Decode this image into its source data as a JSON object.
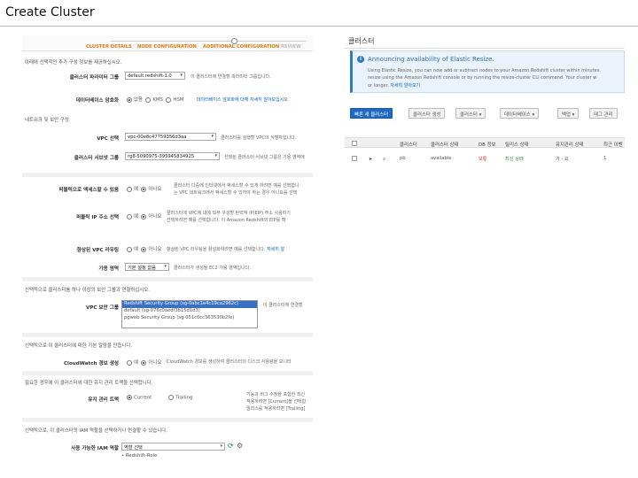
{
  "slide_title": "Create Cluster",
  "wizard": {
    "steps": [
      "CLUSTER DETAILS",
      "NODE CONFIGURATION",
      "ADDITIONAL CONFIGURATION",
      "REVIEW"
    ],
    "intro": "아래에 선택적인 추가 구성 정보를 제공하십시오.",
    "param_group": {
      "label": "클러스터 파라미터 그룹",
      "value": "default.redshift-1.0",
      "help": "이 클러스터에 연결할 파라미터 그룹입니다."
    },
    "encryption": {
      "label": "데이터베이스 암호화",
      "options": [
        "없음",
        "KMS",
        "HSM"
      ],
      "help": "데이터베이스 암호화에 대해 자세히 알아보십시오"
    },
    "network_heading": "네트워크 및 보안 구성",
    "vpc": {
      "label": "VPC 선택",
      "value": "vpc-00e8c47759356d3aa",
      "help": "클러스터를 실행할 VPC의 식별자입니다."
    },
    "subnet_group": {
      "label": "클러스터 서브넷 그룹",
      "value": "rg8-5090975-395945834925",
      "help": "선택된 클러스터 서브넷 그룹은 가용 영역에"
    },
    "publicly_accessible": {
      "label": "퍼블릭으로 액세스할 수 있음",
      "options": [
        "예",
        "아니요"
      ],
      "help": [
        "클러스터 다중에 인터넷에서 액세스할 수 있게 하려면 예를 선택합니",
        "는 VPC 네트워크에서 액세스할 수 있어야 하는 경우 아니요를 선택"
      ]
    },
    "public_ip": {
      "label": "퍼블릭 IP 주소 선택",
      "options": [
        "예",
        "아니요"
      ],
      "help": [
        "클러스터에 VPC에 내에 외부 구성할 탄력적 IP(EIP) 주소 사용하기",
        "선택하려면 예를 선택합니다. 이 Amazon Redshift의 EIP를 확"
      ]
    },
    "enhanced_vpc": {
      "label": "향상된 VPC 라우팅",
      "options": [
        "예",
        "아니요"
      ],
      "help": "향상된 VPC 라우팅을 활성화하려면 예를 선택합니다.",
      "link": "자세히 알"
    },
    "availability_zone": {
      "label": "가용 영역",
      "value": "기본 설정 없음",
      "help": "클러스터가 생성될 EC2 가용 영역입니다."
    },
    "security_group_intro": "선택적으로 클러스터를 하나 이상의 보안 그룹과 연결하십시오.",
    "vpc_security_groups": {
      "label": "VPC 보안 그룹",
      "items": [
        "Redshift Security Group (sg-0abc1e4c19ca2962c)",
        "default (sg-076c0aedf3b15d1d3)",
        "pgweb Security Group (sg-051c0cc363530b2fe)"
      ],
      "help": "이 클러스터에 연결할"
    },
    "alarm_intro": "선택적으로 이 클러스터에 대한 기본 알람을 만듭니다.",
    "cloudwatch": {
      "label": "CloudWatch 경보 생성",
      "options": [
        "예",
        "아니요"
      ],
      "help": "CloudWatch 경보를 생성하여 클러스터의 디스크 사용량을 모니터"
    },
    "maintenance_intro": "필요한 경우에 이 클러스터에 대한 유지 관리 트랙을 선택합니다.",
    "maintenance_track": {
      "label": "유지 관리 트랙",
      "options": [
        "Current",
        "Trailing"
      ],
      "help": [
        "기능과 버그 수정을 포함한 최신",
        "적용하려면 [Current]을 선택합",
        "릴리스를 적용하려면 [Trailing]"
      ]
    },
    "iam_intro": "선택적으로, 이 클러스터의 IAM 역할을 선택하거나 연결할 수 있습니다.",
    "iam_roles": {
      "label": "사용 가능한 IAM 역할",
      "placeholder": "역할 선택",
      "item": "Redshift-Role"
    }
  },
  "console": {
    "title": "클러스터",
    "banner": {
      "heading": "Announcing availability of Elastic Resize.",
      "lines": [
        "Using Elastic Resize, you can now add or subtract nodes to your Amazon Redshift cluster within minutes.",
        "resize using the Amazon Redshift console or by running the resize-cluster CLI command. Your cluster w",
        "or longer."
      ],
      "link": "자세히 알아보기"
    },
    "toolbar": [
      "빠른 새 클러스터",
      "클러스터 생성",
      "클러스터",
      "데이터베이스",
      "백업",
      "태그 관리"
    ],
    "columns": [
      "클러스터",
      "클러스터 상태",
      "DB 정보",
      "릴리스 상태",
      "유지관리 상태",
      "최근 이벤"
    ],
    "rows": [
      {
        "cluster": "pb",
        "cluster_status": "available",
        "db_info": "보통",
        "release_status": "최신 상태",
        "maintenance_status": "가 - 요",
        "recent_events": "1"
      }
    ]
  }
}
